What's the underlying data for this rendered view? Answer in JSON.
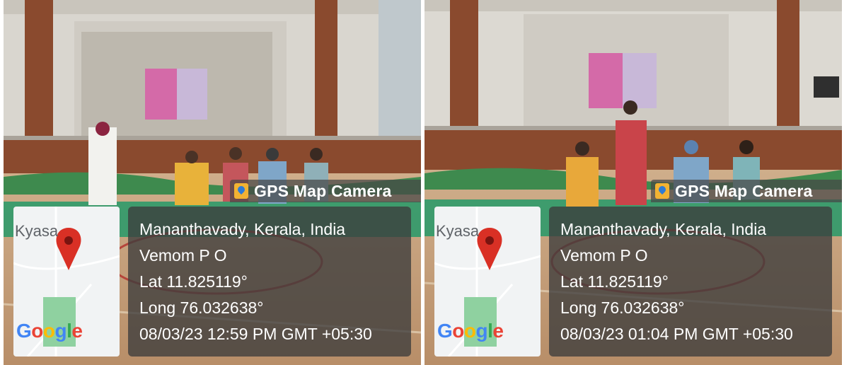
{
  "colors": {
    "hall_wall": "#d8d4cc",
    "stage_wood": "#8a4a2e",
    "floor_wood": "#c9a27c",
    "court_green": "#2f9a6a",
    "overlay_bg": "#3c3c3c",
    "pin_red": "#d93025",
    "map_green": "#8fd1a0"
  },
  "panels": [
    {
      "brand": {
        "icon": "gps-map-camera-app-icon",
        "label": "GPS Map Camera"
      },
      "map": {
        "place_label": "Kyasa",
        "logo_text": "Google",
        "pin_icon": "map-pin-icon"
      },
      "info": {
        "address": "Mananthavady, Kerala, India",
        "po": "Vemom P O",
        "lat": "Lat 11.825119°",
        "long": "Long 76.032638°",
        "datetime": "08/03/23 12:59 PM GMT +05:30"
      }
    },
    {
      "brand": {
        "icon": "gps-map-camera-app-icon",
        "label": "GPS Map Camera"
      },
      "map": {
        "place_label": "Kyasa",
        "logo_text": "Google",
        "pin_icon": "map-pin-icon"
      },
      "info": {
        "address": "Mananthavady, Kerala, India",
        "po": "Vemom P O",
        "lat": "Lat 11.825119°",
        "long": "Long 76.032638°",
        "datetime": "08/03/23 01:04 PM GMT +05:30"
      }
    }
  ]
}
